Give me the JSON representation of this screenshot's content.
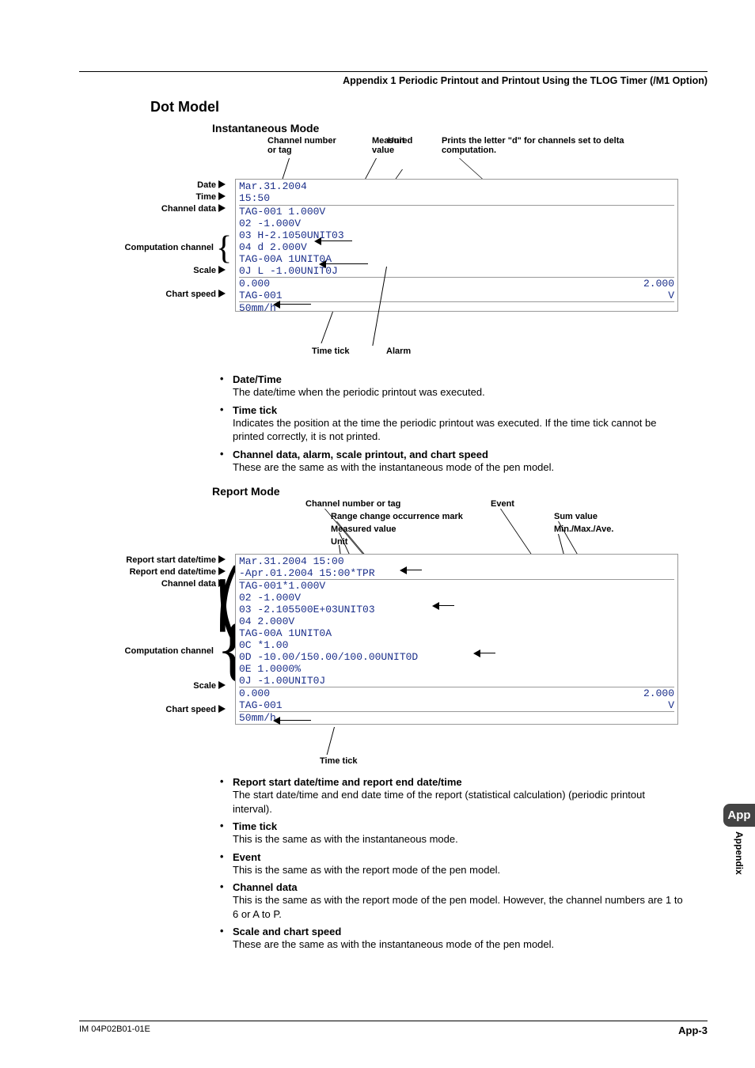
{
  "running_head": "Appendix 1  Periodic Printout and Printout Using the TLOG Timer (/M1 Option)",
  "section_title": "Dot Model",
  "inst": {
    "mode_title": "Instantaneous Mode",
    "top_labels": {
      "chan_or_tag": "Channel number\nor tag",
      "measured": "Measured\nvalue",
      "unit": "Unit",
      "prints_d": "Prints the letter \"d\" for channels set to delta computation."
    },
    "row_labels": {
      "date": "Date",
      "time": "Time",
      "channel_data": "Channel data",
      "computation_channel": "Computation channel",
      "scale": "Scale",
      "chart_speed": "Chart speed"
    },
    "print_lines": {
      "l1": "Mar.31.2004",
      "l2": "15:50",
      "l3": "TAG-001    1.000V",
      "l4": "02        -1.000V",
      "l5": "03       H-2.1050UNIT03",
      "l6": "04     d   2.000V",
      "l7": "TAG-00A    1UNIT0A",
      "l8": "0J       L  -1.00UNIT0J",
      "scale_left": "0.000",
      "scale_right": "2.000",
      "scale_tag": "TAG-001",
      "scale_unit": "V",
      "speed": "50mm/h"
    },
    "bottom_labels": {
      "time_tick": "Time tick",
      "alarm": "Alarm"
    },
    "desc": {
      "date_time_t": "Date/Time",
      "date_time_b": "The date/time when the periodic printout was executed.",
      "time_tick_t": "Time tick",
      "time_tick_b": "Indicates the position at the time the periodic printout was executed. If the time tick cannot be printed correctly, it is not printed.",
      "chan_etc_t": "Channel data, alarm, scale printout, and chart speed",
      "chan_etc_b": "These are the same as with the instantaneous mode of the pen model."
    }
  },
  "report": {
    "mode_title": "Report Mode",
    "top_labels": {
      "chan_or_tag": "Channel number or tag",
      "range_change": "Range change occurrence mark",
      "measured": "Measured value",
      "unit": "Unit",
      "event": "Event",
      "sum": "Sum value",
      "minmaxave": "Min./Max./Ave."
    },
    "row_labels": {
      "start": "Report start date/time",
      "end": "Report end date/time",
      "channel_data": "Channel data",
      "computation_channel": "Computation channel",
      "scale": "Scale",
      "chart_speed": "Chart speed"
    },
    "print_lines": {
      "l1": "Mar.31.2004 15:00",
      "l2": "-Apr.01.2004 15:00*TPR",
      "l3": "TAG-001*1.000V",
      "l4": "02       -1.000V",
      "l5": "03       -2.105500E+03UNIT03",
      "l6": "04        2.000V",
      "l7": "TAG-00A 1UNIT0A",
      "l8": "0C       *1.00",
      "l9": "0D    -10.00/150.00/100.00UNIT0D",
      "l10": "0E        1.0000%",
      "l11": "0J       -1.00UNIT0J",
      "scale_left": "0.000",
      "scale_right": "2.000",
      "scale_tag": "TAG-001",
      "scale_unit": "V",
      "speed": "50mm/h"
    },
    "bottom_labels": {
      "time_tick": "Time tick"
    },
    "desc": {
      "start_end_t": "Report start date/time and report end date/time",
      "start_end_b": "The start date/time and end date time of the report (statistical calculation) (periodic printout interval).",
      "time_tick_t": "Time tick",
      "time_tick_b": "This is the same as with the instantaneous mode.",
      "event_t": "Event",
      "event_b": "This is the same as with the report mode of the pen model.",
      "chan_t": "Channel data",
      "chan_b": "This is the same as with the report mode of the pen model. However, the channel numbers are 1 to 6 or A to P.",
      "scale_t": "Scale and chart speed",
      "scale_b": "These are the same as with the instantaneous mode of the pen model."
    }
  },
  "side_tab": {
    "short": "App",
    "long": "Appendix"
  },
  "footer": {
    "code": "IM 04P02B01-01E",
    "page": "App-3"
  }
}
